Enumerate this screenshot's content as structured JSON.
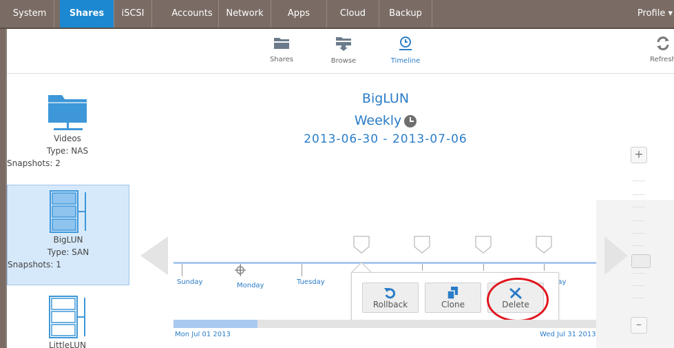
{
  "nav": {
    "tabs": [
      {
        "label": "System"
      },
      {
        "label": "Shares"
      },
      {
        "label": "iSCSI"
      },
      {
        "label": "Accounts"
      },
      {
        "label": "Network"
      },
      {
        "label": "Apps"
      },
      {
        "label": "Cloud"
      },
      {
        "label": "Backup"
      }
    ],
    "active_tab": "Shares",
    "profile_label": "Profile ▾"
  },
  "toolbar": {
    "items": [
      {
        "label": "Shares",
        "icon": "folder-icon"
      },
      {
        "label": "Browse",
        "icon": "browse-icon"
      },
      {
        "label": "Timeline",
        "icon": "clock-icon"
      }
    ],
    "active": "Timeline",
    "refresh_label": "Refresh"
  },
  "shares": [
    {
      "name": "Videos",
      "type": "Type: NAS",
      "snapshots": "Snapshots: 2",
      "icon": "folder-network-icon"
    },
    {
      "name": "BigLUN",
      "type": "Type: SAN",
      "snapshots": "Snapshots: 1",
      "icon": "lun-icon"
    },
    {
      "name": "LittleLUN",
      "icon": "lun-icon"
    }
  ],
  "timeline": {
    "title": "BigLUN",
    "period": "Weekly",
    "date_range": "2013-06-30 - 2013-07-06",
    "days": [
      "Sunday",
      "Monday",
      "Tuesday",
      "day"
    ],
    "start_date": "Mon Jul 01 2013",
    "end_date": "Wed Jul 31 2013"
  },
  "popup": {
    "rollback_label": "Rollback",
    "clone_label": "Clone",
    "delete_label": "Delete"
  },
  "colors": {
    "nav_bg": "#7a6c64",
    "active_tab": "#1b88d1",
    "accent": "#2a7cc8",
    "highlight": "#e0141d"
  }
}
